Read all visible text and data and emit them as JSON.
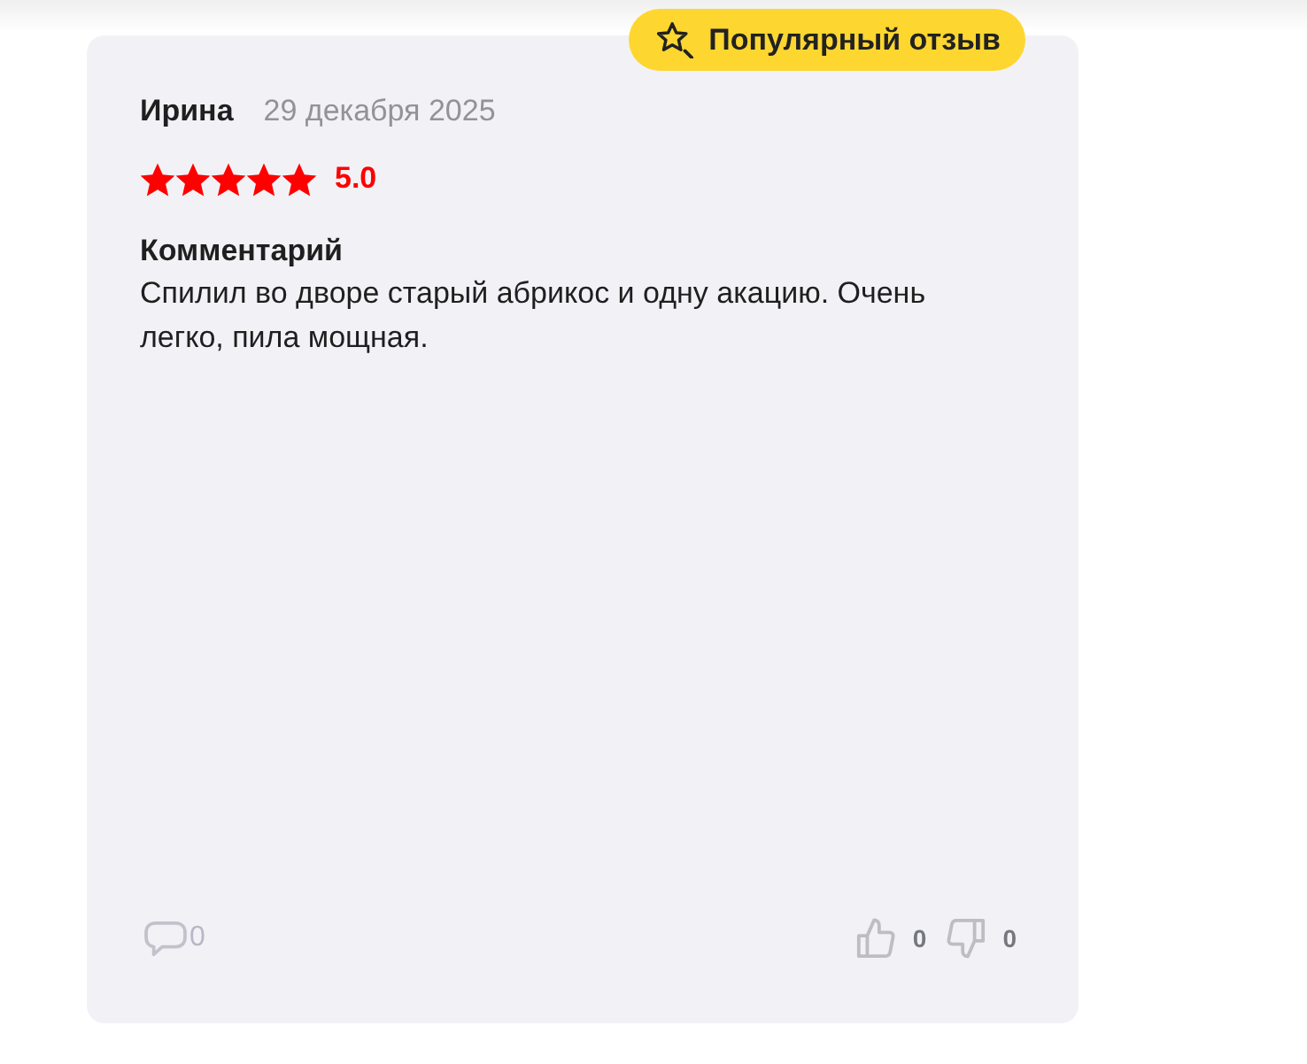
{
  "badge": {
    "label": "Популярный отзыв"
  },
  "review": {
    "author": "Ирина",
    "date": "29 декабря 2025",
    "stars": 5,
    "rating": "5.0",
    "comment_label": "Комментарий",
    "comment": "Спилил во дворе старый абрикос и одну акацию. Очень легко, пила мощная."
  },
  "footer": {
    "replies": "0",
    "likes": "0",
    "dislikes": "0"
  }
}
